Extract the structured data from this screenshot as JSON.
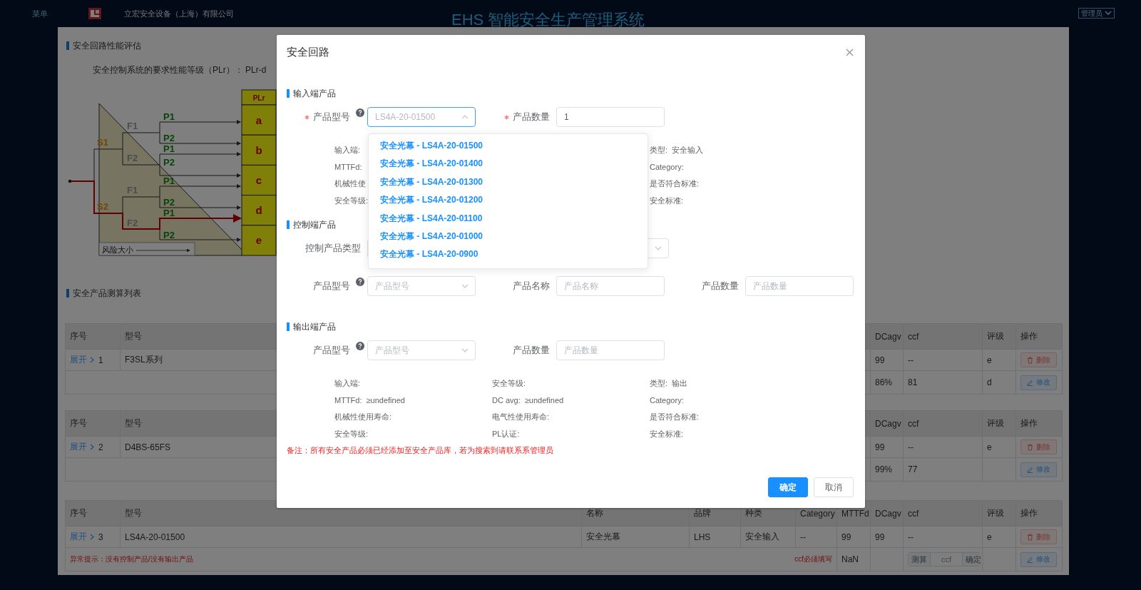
{
  "header": {
    "menu": "菜单",
    "company": "立宏安全设备（上海）有限公司",
    "title": "EHS 智能安全生产管理系统",
    "user": "管理员"
  },
  "evaluation": {
    "title": "安全回路性能评估",
    "plr_text": "安全控制系统的要求性能等级（PLr）： PLr-d",
    "risk_graph": {
      "header": "PLr",
      "levels": [
        "a",
        "b",
        "c",
        "d",
        "e"
      ],
      "severity": [
        "S1",
        "S2"
      ],
      "frequency": [
        "F1",
        "F2",
        "F1",
        "F2"
      ],
      "possibility": [
        "P1",
        "P2",
        "P1",
        "P2",
        "P1",
        "P2",
        "P1",
        "P2"
      ],
      "scale_label": "风险大小"
    }
  },
  "product_list": {
    "title": "安全产品测算列表",
    "tables": [
      {
        "header": {
          "seq": "序号",
          "model": "型号",
          "dcagv": "DCagv",
          "ccf": "ccf",
          "grade": "评级",
          "action": "操作"
        },
        "row": {
          "expand": "展开",
          "seq": "1",
          "model": "F3SL系列",
          "dcagv": "99",
          "ccf": "--",
          "grade": "e",
          "action": "删除"
        },
        "sub_row": {
          "dcagv": "86%",
          "ccf": "81",
          "grade": "d",
          "action": "修改"
        }
      },
      {
        "header": {
          "seq": "序号",
          "model": "型号",
          "dcagv": "DCagv",
          "ccf": "ccf",
          "grade": "评级",
          "action": "操作"
        },
        "row": {
          "expand": "展开",
          "seq": "2",
          "model": "D4BS-65FS",
          "dcagv": "99",
          "ccf": "--",
          "grade": "e",
          "action": "删除"
        },
        "sub_row": {
          "dcagv": "99%",
          "ccf": "77",
          "action": "修改"
        }
      },
      {
        "header": {
          "seq": "序号",
          "model": "型号",
          "name": "名称",
          "brand": "品牌",
          "type": "种类",
          "category": "Category",
          "mttfd": "MTTFd",
          "dcagv": "DCagv",
          "ccf": "ccf",
          "grade": "评级",
          "action": "操作"
        },
        "row": {
          "expand": "展开",
          "seq": "3",
          "model": "LS4A-20-01500",
          "name": "安全光幕",
          "brand": "LHS",
          "type": "安全输入",
          "category": "--",
          "mttfd": "99",
          "dcagv": "99",
          "ccf": "--",
          "grade": "e",
          "action": "删除"
        },
        "sub_row": {
          "warning": "异常提示：没有控制产品/没有输出产品",
          "ccf_warning": "ccf必须填写",
          "mttfd": "NaN",
          "ccf_input": {
            "calc": "测算",
            "placeholder": "ccf",
            "confirm": "确定"
          },
          "action": "修改"
        }
      }
    ]
  },
  "dialog": {
    "title": "安全回路",
    "sections": [
      {
        "title": "输入端产品",
        "rows": [
          [
            {
              "kind": "select",
              "label": "产品型号",
              "required": true,
              "help": true,
              "placeholder": "LS4A-20-01500",
              "expanded": true,
              "focused": true
            },
            {
              "kind": "input",
              "label": "产品数量",
              "required": true,
              "help": false,
              "value": "1",
              "focused": false
            }
          ]
        ],
        "info": [
          {
            "left": {
              "label": "输入端:"
            },
            "right": {
              "label": "类型:",
              "value": "安全输入"
            }
          },
          {
            "left": {
              "label": "MTTFd:"
            },
            "right": {
              "label": "Category:"
            }
          },
          {
            "left": {
              "label": "机械性使"
            },
            "right": {
              "label": "是否符合标准:"
            }
          },
          {
            "left": {
              "label": "安全等级:"
            },
            "right": {
              "label": "安全标准:"
            }
          }
        ]
      },
      {
        "title": "控制端产品",
        "rows": [
          [
            {
              "kind": "type-select",
              "label": "控制产品类型",
              "required": false,
              "help": false,
              "expanded": false,
              "focused": false
            }
          ],
          [
            {
              "kind": "select",
              "label": "产品型号",
              "required": false,
              "help": true,
              "placeholder": "产品型号",
              "expanded": false,
              "focused": false
            },
            {
              "kind": "input",
              "label": "产品名称",
              "required": false,
              "help": false,
              "placeholder": "产品名称",
              "focused": false
            },
            {
              "kind": "input",
              "label": "产品数量",
              "required": false,
              "help": false,
              "placeholder": "产品数量",
              "focused": false
            }
          ]
        ]
      },
      {
        "title": "输出端产品",
        "rows": [
          [
            {
              "kind": "select",
              "label": "产品型号",
              "required": false,
              "help": true,
              "placeholder": "产品型号",
              "expanded": false,
              "focused": false
            },
            {
              "kind": "input",
              "label": "产品数量",
              "required": false,
              "help": false,
              "placeholder": "产品数量",
              "focused": false
            }
          ]
        ],
        "info": [
          {
            "left": {
              "label": "输入端:"
            },
            "middle": {
              "label": "安全等级:"
            },
            "right": {
              "label": "类型:",
              "value": "输出"
            }
          },
          {
            "left": {
              "label": "MTTFd:",
              "value": "≥undefined"
            },
            "middle": {
              "label": "DC avg:",
              "value": "≥undefined"
            },
            "right": {
              "label": "Category:"
            }
          },
          {
            "left": {
              "label": "机械性使用寿命:"
            },
            "middle": {
              "label": "电气性使用寿命:"
            },
            "right": {
              "label": "是否符合标准:"
            }
          },
          {
            "left": {
              "label": "安全等级:"
            },
            "middle": {
              "label": "PL认证:"
            },
            "right": {
              "label": "安全标准:"
            }
          }
        ]
      }
    ],
    "dropdown": {
      "options": [
        "安全光幕 - LS4A-20-01500",
        "安全光幕 - LS4A-20-01400",
        "安全光幕 - LS4A-20-01300",
        "安全光幕 - LS4A-20-01200",
        "安全光幕 - LS4A-20-01100",
        "安全光幕 - LS4A-20-01000",
        "安全光幕 - LS4A-20-0900"
      ]
    },
    "note": "备注：所有安全产品必须已经添加至安全产品库，若为搜索到请联系系管理员",
    "buttons": [
      {
        "label": "确定",
        "primary": true
      },
      {
        "label": "取消",
        "primary": false
      }
    ]
  }
}
